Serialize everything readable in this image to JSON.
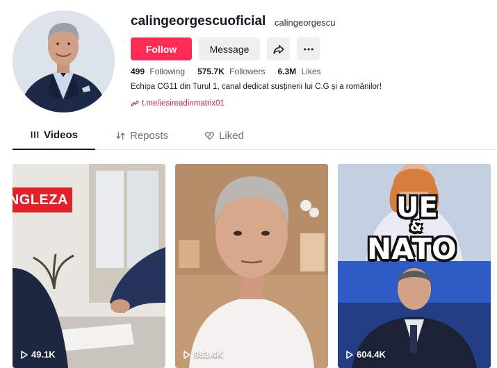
{
  "profile": {
    "username": "calingeorgescuoficial",
    "nickname": "calingeorgescu",
    "follow_label": "Follow",
    "message_label": "Message",
    "share_icon": "share-icon",
    "more_icon": "more-icon",
    "stats": {
      "following_count": "499",
      "following_label": "Following",
      "followers_count": "575.7K",
      "followers_label": "Followers",
      "likes_count": "6.3M",
      "likes_label": "Likes"
    },
    "bio": "Echipa CG11 din Turul 1, canal dedicat susținerii lui C.G și a românilor!",
    "link": "t.me/iesireadinmatrix01"
  },
  "tabs": [
    {
      "label": "Videos",
      "icon": "grid-icon",
      "active": true
    },
    {
      "label": "Reposts",
      "icon": "repost-icon",
      "active": false
    },
    {
      "label": "Liked",
      "icon": "heart-icon",
      "active": false
    }
  ],
  "videos": [
    {
      "views": "49.1K",
      "overlay_text": "NGLEZA"
    },
    {
      "views": "983.4K",
      "overlay_text": ""
    },
    {
      "views": "604.4K",
      "overlay_text_top": "UE",
      "overlay_text_mid": "&",
      "overlay_text_bottom": "NATO"
    }
  ],
  "colors": {
    "accent": "#fe2c55",
    "link": "#c0284a",
    "text": "#161823"
  }
}
